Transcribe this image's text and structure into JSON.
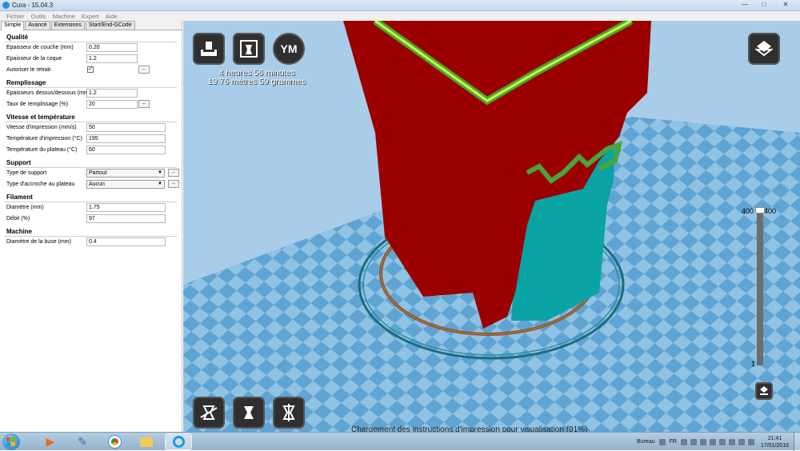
{
  "window": {
    "title": "Cura - 15.04.3"
  },
  "window_controls": {
    "minimize": "—",
    "maximize": "□",
    "close": "✕"
  },
  "menu": [
    "Fichier",
    "Outils",
    "Machine",
    "Expert",
    "Aide"
  ],
  "tabs": [
    "Simple",
    "Avancé",
    "Extensions",
    "Start/End-GCode"
  ],
  "sections": {
    "qualite": {
      "title": "Qualité",
      "layer_height": {
        "label": "Epaisseur de couche (mm)",
        "value": "0.20"
      },
      "shell_thickness": {
        "label": "Epaisseur de la coque",
        "value": "1.2"
      },
      "retraction": {
        "label": "Autoriser le retrait",
        "checked": "✓"
      }
    },
    "remplissage": {
      "title": "Remplissage",
      "bottom_top": {
        "label": "Epaisseurs dessus/dessous (mm)",
        "value": "1.2"
      },
      "fill_density": {
        "label": "Taux de remplissage (%)",
        "value": "20"
      }
    },
    "vitesse": {
      "title": "Vitesse et température",
      "print_speed": {
        "label": "Vitesse d'impression (mm/s)",
        "value": "50"
      },
      "print_temp": {
        "label": "Température d'impression (°C)",
        "value": "195"
      },
      "bed_temp": {
        "label": "Température du plateau (°C)",
        "value": "60"
      }
    },
    "support": {
      "title": "Support",
      "support_type": {
        "label": "Type de support",
        "value": "Partout"
      },
      "adhesion": {
        "label": "Type d'accroche au plateau",
        "value": "Aucun"
      }
    },
    "filament": {
      "title": "Filament",
      "diameter": {
        "label": "Diamètre (mm)",
        "value": "1.75"
      },
      "flow": {
        "label": "Débit (%)",
        "value": "97"
      }
    },
    "machine": {
      "title": "Machine",
      "nozzle": {
        "label": "Diamètre de la buse (mm)",
        "value": "0.4"
      }
    }
  },
  "more_button": "...",
  "viewport": {
    "print_time": "4 heures 56 minutes",
    "print_material": "19.76 mètres 59 grammes",
    "ym_label": "YM",
    "layer_top_left": "400",
    "layer_top_right": "400",
    "layer_bottom": "1",
    "status_message": "Chargement des instructions d'impression pour visualisation (91%)"
  },
  "taskbar": {
    "desktop_label": "Bureau",
    "lang": "FR",
    "time": "21:41",
    "date": "17/01/2016"
  },
  "colors": {
    "model_red": "#9b0000",
    "support_cyan": "#0aa3a3",
    "plate_light": "#8fc2e3",
    "plate_dark": "#5fa4d3"
  }
}
